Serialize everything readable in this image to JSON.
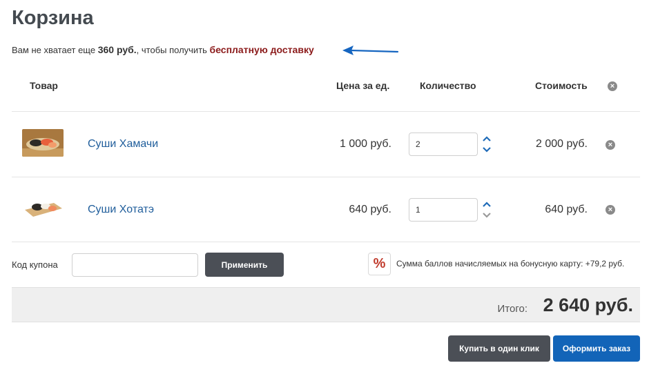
{
  "page": {
    "title": "Корзина"
  },
  "delivery": {
    "prefix": "Вам не хватает еще ",
    "amount": "360 руб.",
    "middle": ", чтобы получить ",
    "link": "бесплатную доставку",
    "arrow_color": "#1565c0"
  },
  "table": {
    "headers": {
      "product": "Товар",
      "price": "Цена за ед.",
      "quantity": "Количество",
      "cost": "Стоимость"
    },
    "rows": [
      {
        "name": "Суши Хамачи",
        "price": "1 000 руб.",
        "quantity": "2",
        "cost": "2 000 руб."
      },
      {
        "name": "Суши Хотатэ",
        "price": "640 руб.",
        "quantity": "1",
        "cost": "640 руб."
      }
    ]
  },
  "coupon": {
    "label": "Код купона",
    "value": "",
    "apply_label": "Применить"
  },
  "bonus": {
    "icon": "%",
    "text": "Сумма баллов начисляемых на бонусную карту: +79,2 руб."
  },
  "total": {
    "label": "Итого:",
    "value": "2 640 руб."
  },
  "actions": {
    "one_click_label": "Купить в один клик",
    "checkout_label": "Оформить заказ"
  },
  "colors": {
    "accent_blue": "#1264b8",
    "link_blue": "#1f5d9b",
    "delivery_red": "#8b1a1a",
    "dark_button": "#4b4f56"
  }
}
